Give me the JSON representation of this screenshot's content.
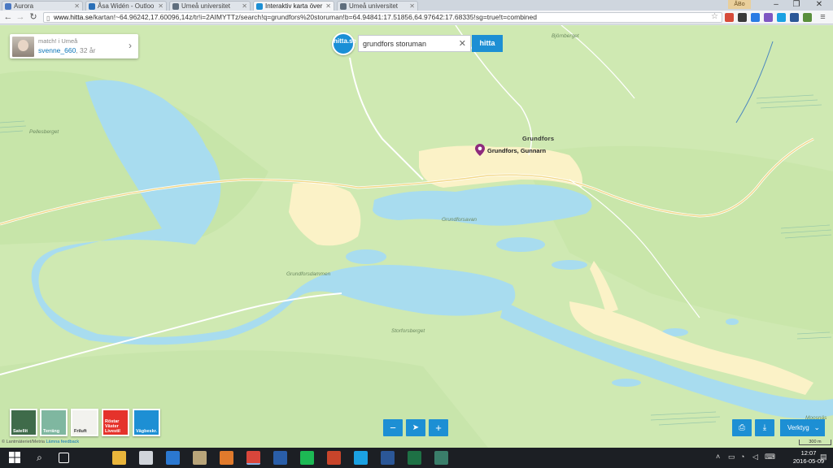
{
  "browser": {
    "tabs": [
      {
        "label": "Aurora",
        "color": "#4a78c2"
      },
      {
        "label": "Åsa Widén - Outloo",
        "color": "#2a6fb7"
      },
      {
        "label": "Umeå universitet",
        "color": "#5f6e7d"
      },
      {
        "label": "Interaktiv karta över",
        "color": "#1d8fd4"
      },
      {
        "label": "Umeå universitet",
        "color": "#5f6e7d"
      }
    ],
    "active_tab": 3,
    "user_label": "ÅBo",
    "url_host": "www.hitta.se",
    "url_path": "/kartan!~64.96242,17.60096,14z/tr!i=2AIMYTTz/search!q=grundfors%20storuman!b=64.94841:17.51856,64.97642:17.68335!sg=true!t=combined"
  },
  "user_card": {
    "match_text": "match! i Umeå",
    "username": "svenne_660",
    "age": ", 32 år"
  },
  "logo_text": "hitta.se",
  "search": {
    "value": "grundfors storuman",
    "button_label": "hitta"
  },
  "map": {
    "place_labels": {
      "bjornberget": "Björnberget",
      "pellesberget": "Pellesberget",
      "grundforsavan": "Grundforsavan",
      "grundforsdammen": "Grundforsdammen",
      "storforsberget": "Storforsberget",
      "moosnas": "Moosnäs"
    },
    "town_label": "Grundfors",
    "pin_label": "Grundfors, Gunnarn",
    "layers": [
      {
        "label": "Satellit",
        "color": "#3f6b4a"
      },
      {
        "label": "Terräng",
        "color": "#7fb7a0"
      },
      {
        "label": "Friluft",
        "color": "#f2f2ee"
      },
      {
        "label": "Röstar Väster Livestil",
        "color": "#e5322b"
      },
      {
        "label": "Vägbeskr.",
        "color": "#1d8fd4"
      }
    ],
    "tools_label": "Verktyg",
    "attribution": "© Lantmäteriet/Metria",
    "feedback_link": "Lämna feedback",
    "scale_label": "300 m"
  },
  "taskbar": {
    "time": "12:07",
    "date": "2016-05-09",
    "apps": [
      {
        "name": "file-explorer",
        "color": "#e9b53b"
      },
      {
        "name": "store",
        "color": "#d0d4da"
      },
      {
        "name": "edge",
        "color": "#2b78d0"
      },
      {
        "name": "notes",
        "color": "#b9a57a"
      },
      {
        "name": "picasa",
        "color": "#e07a2c"
      },
      {
        "name": "chrome",
        "color": "#d9463b"
      },
      {
        "name": "network",
        "color": "#2a5ea8"
      },
      {
        "name": "spotify",
        "color": "#1db954"
      },
      {
        "name": "powerpoint",
        "color": "#c8452b"
      },
      {
        "name": "skype",
        "color": "#1ba1e2"
      },
      {
        "name": "word",
        "color": "#2b5797"
      },
      {
        "name": "excel",
        "color": "#1e7145"
      },
      {
        "name": "search-app",
        "color": "#3a7e6a"
      }
    ]
  }
}
